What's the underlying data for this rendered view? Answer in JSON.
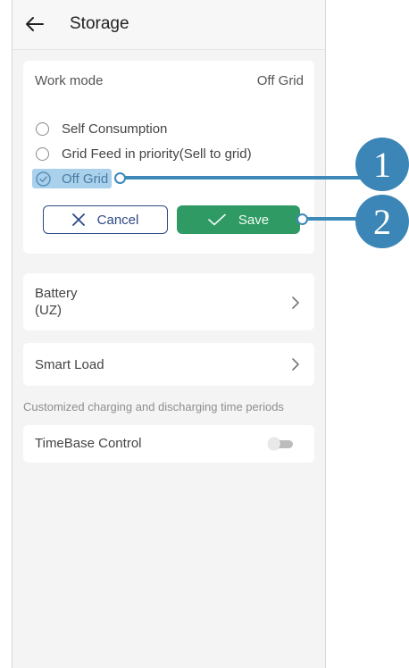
{
  "header": {
    "title": "Storage"
  },
  "work_mode": {
    "label": "Work mode",
    "value": "Off Grid",
    "options": [
      {
        "label": "Self Consumption",
        "selected": false
      },
      {
        "label": "Grid Feed in priority(Sell to grid)",
        "selected": false
      },
      {
        "label": "Off Grid",
        "selected": true
      }
    ],
    "cancel_label": "Cancel",
    "save_label": "Save"
  },
  "battery": {
    "label_line1": "Battery",
    "label_line2": "(UZ)"
  },
  "smart_load": {
    "label": "Smart Load"
  },
  "hint": "Customized charging and discharging time periods",
  "timebase": {
    "label": "TimeBase Control",
    "enabled": false
  },
  "callouts": [
    "1",
    "2"
  ],
  "colors": {
    "accent_blue": "#3b86b7",
    "save_green": "#2f9a63",
    "cancel_blue": "#2e4a86"
  }
}
